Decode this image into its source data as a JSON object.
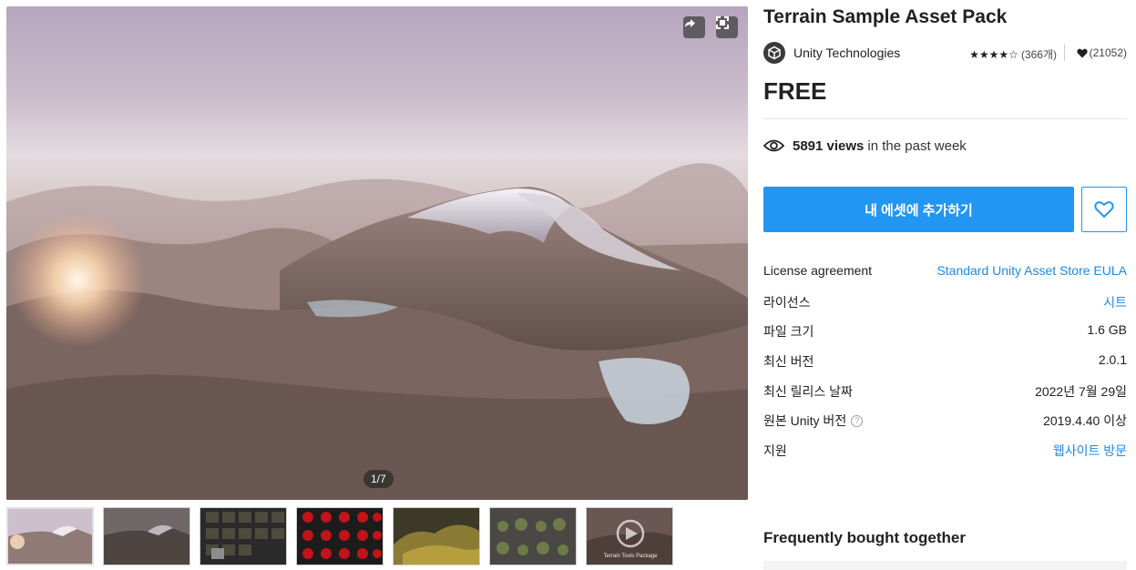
{
  "gallery": {
    "counter": "1/7",
    "thumbnails": [
      {
        "name": "terrain-mountain"
      },
      {
        "name": "terrain-mountain-dark"
      },
      {
        "name": "material-grid"
      },
      {
        "name": "red-brush-grid"
      },
      {
        "name": "terrain-yellow"
      },
      {
        "name": "vegetation-set"
      },
      {
        "name": "terrain-tools-package",
        "caption": "Terrain Tools Package"
      }
    ]
  },
  "product": {
    "title": "Terrain Sample Asset Pack",
    "publisher": "Unity Technologies",
    "rating_count": "(366개)",
    "favorites": "(21052)",
    "price": "FREE",
    "views_count": "5891 views",
    "views_suffix": "in the past week",
    "add_button": "내 에셋에 추가하기",
    "colors": {
      "accent": "#2196f3",
      "link": "#1e88e5"
    }
  },
  "details": {
    "license_agreement_label": "License agreement",
    "license_agreement_value": "Standard Unity Asset Store EULA",
    "license_label": "라이선스",
    "license_value": "시트",
    "file_size_label": "파일 크기",
    "file_size_value": "1.6 GB",
    "latest_version_label": "최신 버전",
    "latest_version_value": "2.0.1",
    "release_date_label": "최신 릴리스 날짜",
    "release_date_value": "2022년 7월 29일",
    "unity_version_label": "원본 Unity 버전",
    "unity_version_help": "?",
    "unity_version_value": "2019.4.40 이상",
    "support_label": "지원",
    "support_value": "웹사이트 방문"
  },
  "sections": {
    "frequently_bought": "Frequently bought together"
  }
}
